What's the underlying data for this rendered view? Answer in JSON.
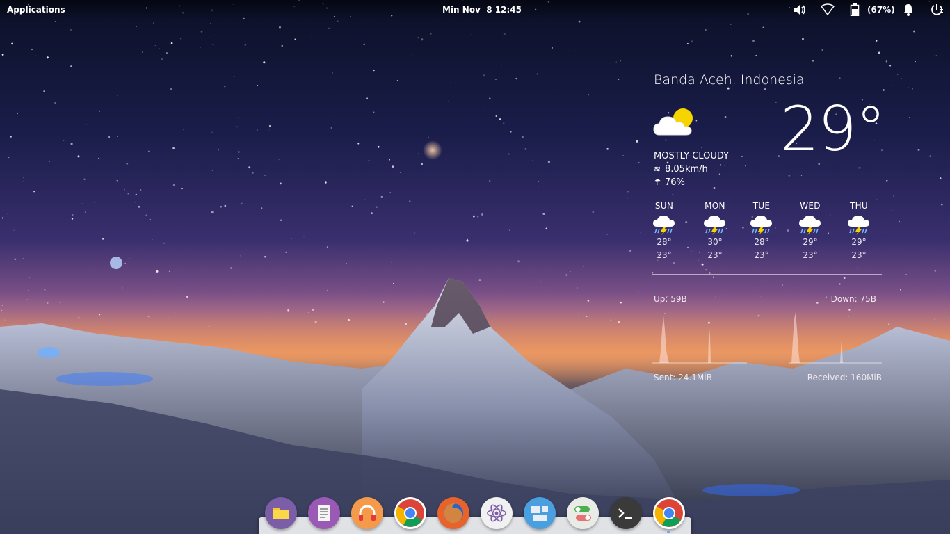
{
  "panel": {
    "applications_label": "Applications",
    "clock": "Min Nov  8 12:45",
    "battery_percent": "(67%)",
    "tray_icons": [
      "volume-icon",
      "wifi-icon",
      "battery-icon",
      "notifications-bell-icon",
      "power-session-icon"
    ]
  },
  "weather": {
    "location": "Banda Aceh, Indonesia",
    "temperature": "29°",
    "condition": "MOSTLY CLOUDY",
    "wind": "8.05km/h",
    "humidity": "76%",
    "icon": "partly-cloudy-icon",
    "forecast": [
      {
        "day": "SUN",
        "high": "28°",
        "low": "23°",
        "icon": "thunderstorm-icon"
      },
      {
        "day": "MON",
        "high": "30°",
        "low": "23°",
        "icon": "thunderstorm-icon"
      },
      {
        "day": "TUE",
        "high": "28°",
        "low": "23°",
        "icon": "thunderstorm-icon"
      },
      {
        "day": "WED",
        "high": "29°",
        "low": "23°",
        "icon": "thunderstorm-icon"
      },
      {
        "day": "THU",
        "high": "29°",
        "low": "23°",
        "icon": "thunderstorm-icon"
      }
    ]
  },
  "network": {
    "up": "Up: 59B",
    "down": "Down: 75B",
    "sent": "Sent: 24.1MiB",
    "received": "Received: 160MiB"
  },
  "dock": {
    "items": [
      {
        "name": "files",
        "icon": "folder-icon",
        "color": "#7b5ea7"
      },
      {
        "name": "text-editor",
        "icon": "document-icon",
        "color": "#9b59b6"
      },
      {
        "name": "music-player",
        "icon": "headphones-icon",
        "color": "#f59a4a"
      },
      {
        "name": "chrome",
        "icon": "chrome-icon",
        "color": "#ffffff"
      },
      {
        "name": "firefox",
        "icon": "firefox-icon",
        "color": "#e8632b"
      },
      {
        "name": "atom",
        "icon": "atom-icon",
        "color": "#f1f1f1"
      },
      {
        "name": "window-manager",
        "icon": "windows-icon",
        "color": "#4a9fe0"
      },
      {
        "name": "settings-toggle",
        "icon": "toggle-icon",
        "color": "#e9ece6"
      },
      {
        "name": "terminal",
        "icon": "terminal-icon",
        "color": "#3a3a3a"
      },
      {
        "name": "chrome-running",
        "icon": "chrome-icon",
        "color": "#ffffff"
      }
    ]
  },
  "colors": {
    "dock_bg": "#f0f0f2",
    "active_indicator": "#6aa7ff",
    "text": "#ffffff"
  }
}
